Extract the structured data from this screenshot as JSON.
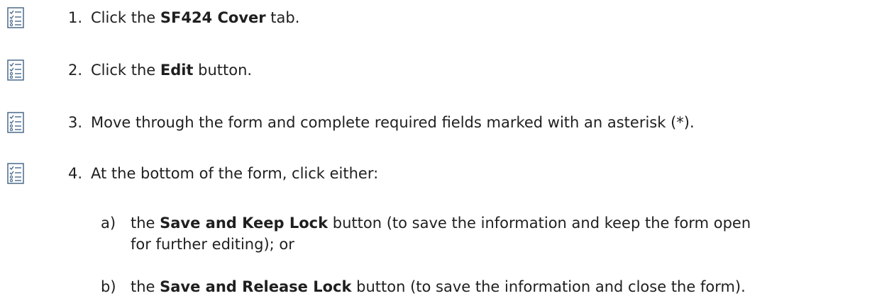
{
  "steps": [
    {
      "number": "1.",
      "icon": "checklist-icon",
      "before": "Click the ",
      "bold": "SF424 Cover",
      "after": " tab."
    },
    {
      "number": "2.",
      "icon": "checklist-icon",
      "before": "Click the ",
      "bold": "Edit",
      "after": " button."
    },
    {
      "number": "3.",
      "icon": "checklist-icon",
      "before": "Move through the form and complete required fields marked with an asterisk (*).",
      "bold": "",
      "after": ""
    },
    {
      "number": "4.",
      "icon": "checklist-icon",
      "before": "At the bottom of the form, click either:",
      "bold": "",
      "after": ""
    }
  ],
  "substeps": [
    {
      "letter": "a)",
      "before": "the ",
      "bold": "Save and Keep Lock",
      "after_line1": " button (to save the information and keep the form open",
      "after_line2": "for further editing); or"
    },
    {
      "letter": "b)",
      "before": "the ",
      "bold": "Save and Release Lock",
      "after_line1": " button (to save the information and close the form).",
      "after_line2": ""
    }
  ],
  "colors": {
    "text": "#1f1f1f",
    "icon": "#4a6a8a"
  }
}
